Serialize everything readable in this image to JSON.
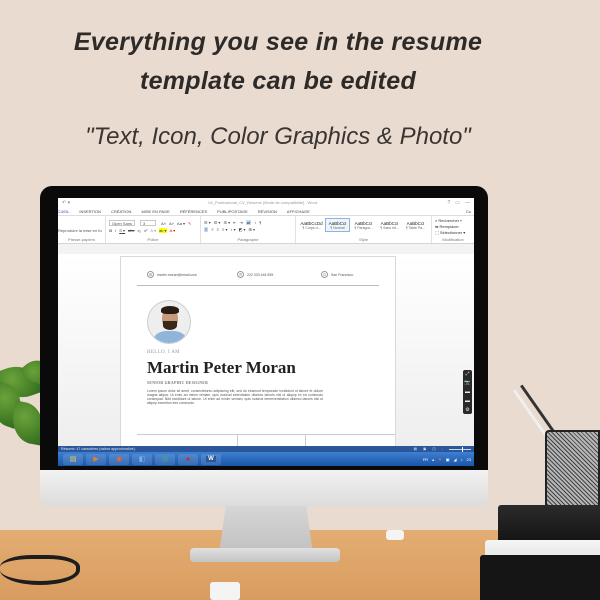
{
  "promo": {
    "headline_line1": "Everything you see in the resume",
    "headline_line2": "template can be edited",
    "subline": "\"Text, Icon, Color Graphics & Photo\""
  },
  "word": {
    "title": "04_Professional_CV_Resume [Mode de compatibilité] - Word",
    "quick_access": "↶ ▾",
    "window_controls": [
      "?",
      "▭",
      "—"
    ],
    "tabs": [
      {
        "label": "ACCUEIL",
        "active": true
      },
      {
        "label": "INSERTION"
      },
      {
        "label": "CRÉATION"
      },
      {
        "label": "MISE EN PAGE"
      },
      {
        "label": "RÉFÉRENCES"
      },
      {
        "label": "PUBLIPOSTAGE"
      },
      {
        "label": "RÉVISION"
      },
      {
        "label": "AFFICHAGE"
      }
    ],
    "account": "Co",
    "ribbon": {
      "clipboard": {
        "action": "Reproduire la mise en forme",
        "label": "Presse-papiers"
      },
      "font": {
        "font_name": "Open Sans",
        "font_size": "3",
        "label": "Police",
        "row1": [
          "A˄",
          "A˅",
          "Aa ▾",
          "✎"
        ],
        "row2": [
          "G",
          "I",
          "S ▾",
          "abc",
          "x₂",
          "x²",
          "A ▾",
          "ab ▾",
          "A ▾"
        ]
      },
      "paragraph": {
        "label": "Paragraphe",
        "row1": [
          "☰ ▾",
          "☰ ▾",
          "☰ ▾",
          "⇤",
          "⇥",
          "⇄",
          "↕",
          "¶"
        ],
        "row2": [
          "≡",
          "≡",
          "≡",
          "≡ ▾",
          "↕ ▾",
          "◩ ▾",
          "⊞ ▾"
        ]
      },
      "styles": {
        "label": "Style",
        "items": [
          {
            "sample": "AaBbCcDd",
            "name": "¶ Corps d..."
          },
          {
            "sample": "AaBbCcI",
            "name": "¶ Normal",
            "selected": true
          },
          {
            "sample": "AaBbCcI",
            "name": "¶ Paragra..."
          },
          {
            "sample": "AaBbCcI",
            "name": "¶ Sans int..."
          },
          {
            "sample": "AaBbCcI",
            "name": "¶ Table Pa..."
          }
        ]
      },
      "editing": {
        "label": "Modification",
        "items": [
          "Rechercher ▾",
          "Remplacer",
          "Sélectionner ▾"
        ]
      }
    },
    "document": {
      "email": "martin.moran@email.com",
      "phone": "222 333 444 555",
      "location": "San Francisco",
      "hello": "HELLO, I AM",
      "name": "Martin Peter Moran",
      "role": "SENIOR GRAPHIC DESIGNER",
      "bio": "Lorem ipsum dolor sit amet, consectetureu adipiscing elit, sed do eiusmod temporade incididunt ut labore et dolore magna aliqua. Ut enim ad minim veniam, quis nostrud exercitation ullamco laboris nisi ut aliquip ex ea commodo consequat. Nibt incididunt ut labore. Ut enim ad minim veniam, quis nostrud bereexercitation ullamco laboris nisi ut aliquip exeretion ees commodo."
    },
    "side_tools": [
      "⤢",
      "📷",
      "▬",
      "▬",
      "⚙"
    ],
    "status": {
      "text": "Résumé: 47 caractères (valeur approximative).",
      "zoom_percent": 60
    }
  },
  "taskbar": {
    "apps": [
      {
        "name": "file-explorer",
        "glyph": "▤",
        "color": "#f2d15c"
      },
      {
        "name": "media-player",
        "glyph": "▶",
        "color": "#f07c22"
      },
      {
        "name": "firefox",
        "glyph": "◉",
        "color": "#e8692b"
      },
      {
        "name": "camera-app",
        "glyph": "◧",
        "color": "#3a8ee6"
      },
      {
        "name": "chrome",
        "glyph": "◎",
        "color": "#2f9e44"
      },
      {
        "name": "record",
        "glyph": "●",
        "color": "#e02020"
      },
      {
        "name": "word",
        "glyph": "W",
        "color": "#2b579a"
      }
    ],
    "tray": [
      "FR",
      "▴",
      "⚑",
      "▣",
      "◢",
      "♪",
      "23"
    ]
  }
}
